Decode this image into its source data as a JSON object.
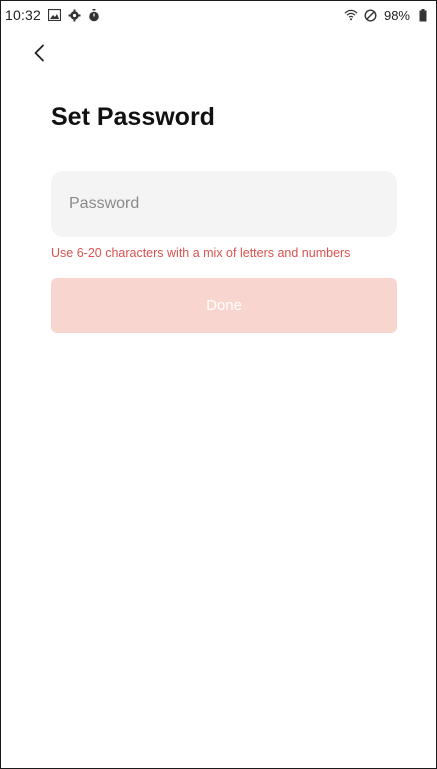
{
  "status_bar": {
    "time": "10:32",
    "left_icons": [
      "gallery-icon",
      "settings-gear-icon",
      "timer-icon"
    ],
    "right_icons": [
      "wifi-icon",
      "do-not-disturb-icon",
      "battery-icon"
    ],
    "battery": "98%"
  },
  "nav": {
    "back_icon": "chevron-left-icon"
  },
  "page": {
    "title": "Set Password"
  },
  "form": {
    "password_placeholder": "Password",
    "password_value": "",
    "hint": "Use 6-20 characters with a mix of letters and numbers",
    "done_label": "Done",
    "done_enabled": false
  },
  "colors": {
    "hint": "#d9534f",
    "done_bg_disabled": "#f9d5cf",
    "input_bg": "#f4f4f4"
  }
}
